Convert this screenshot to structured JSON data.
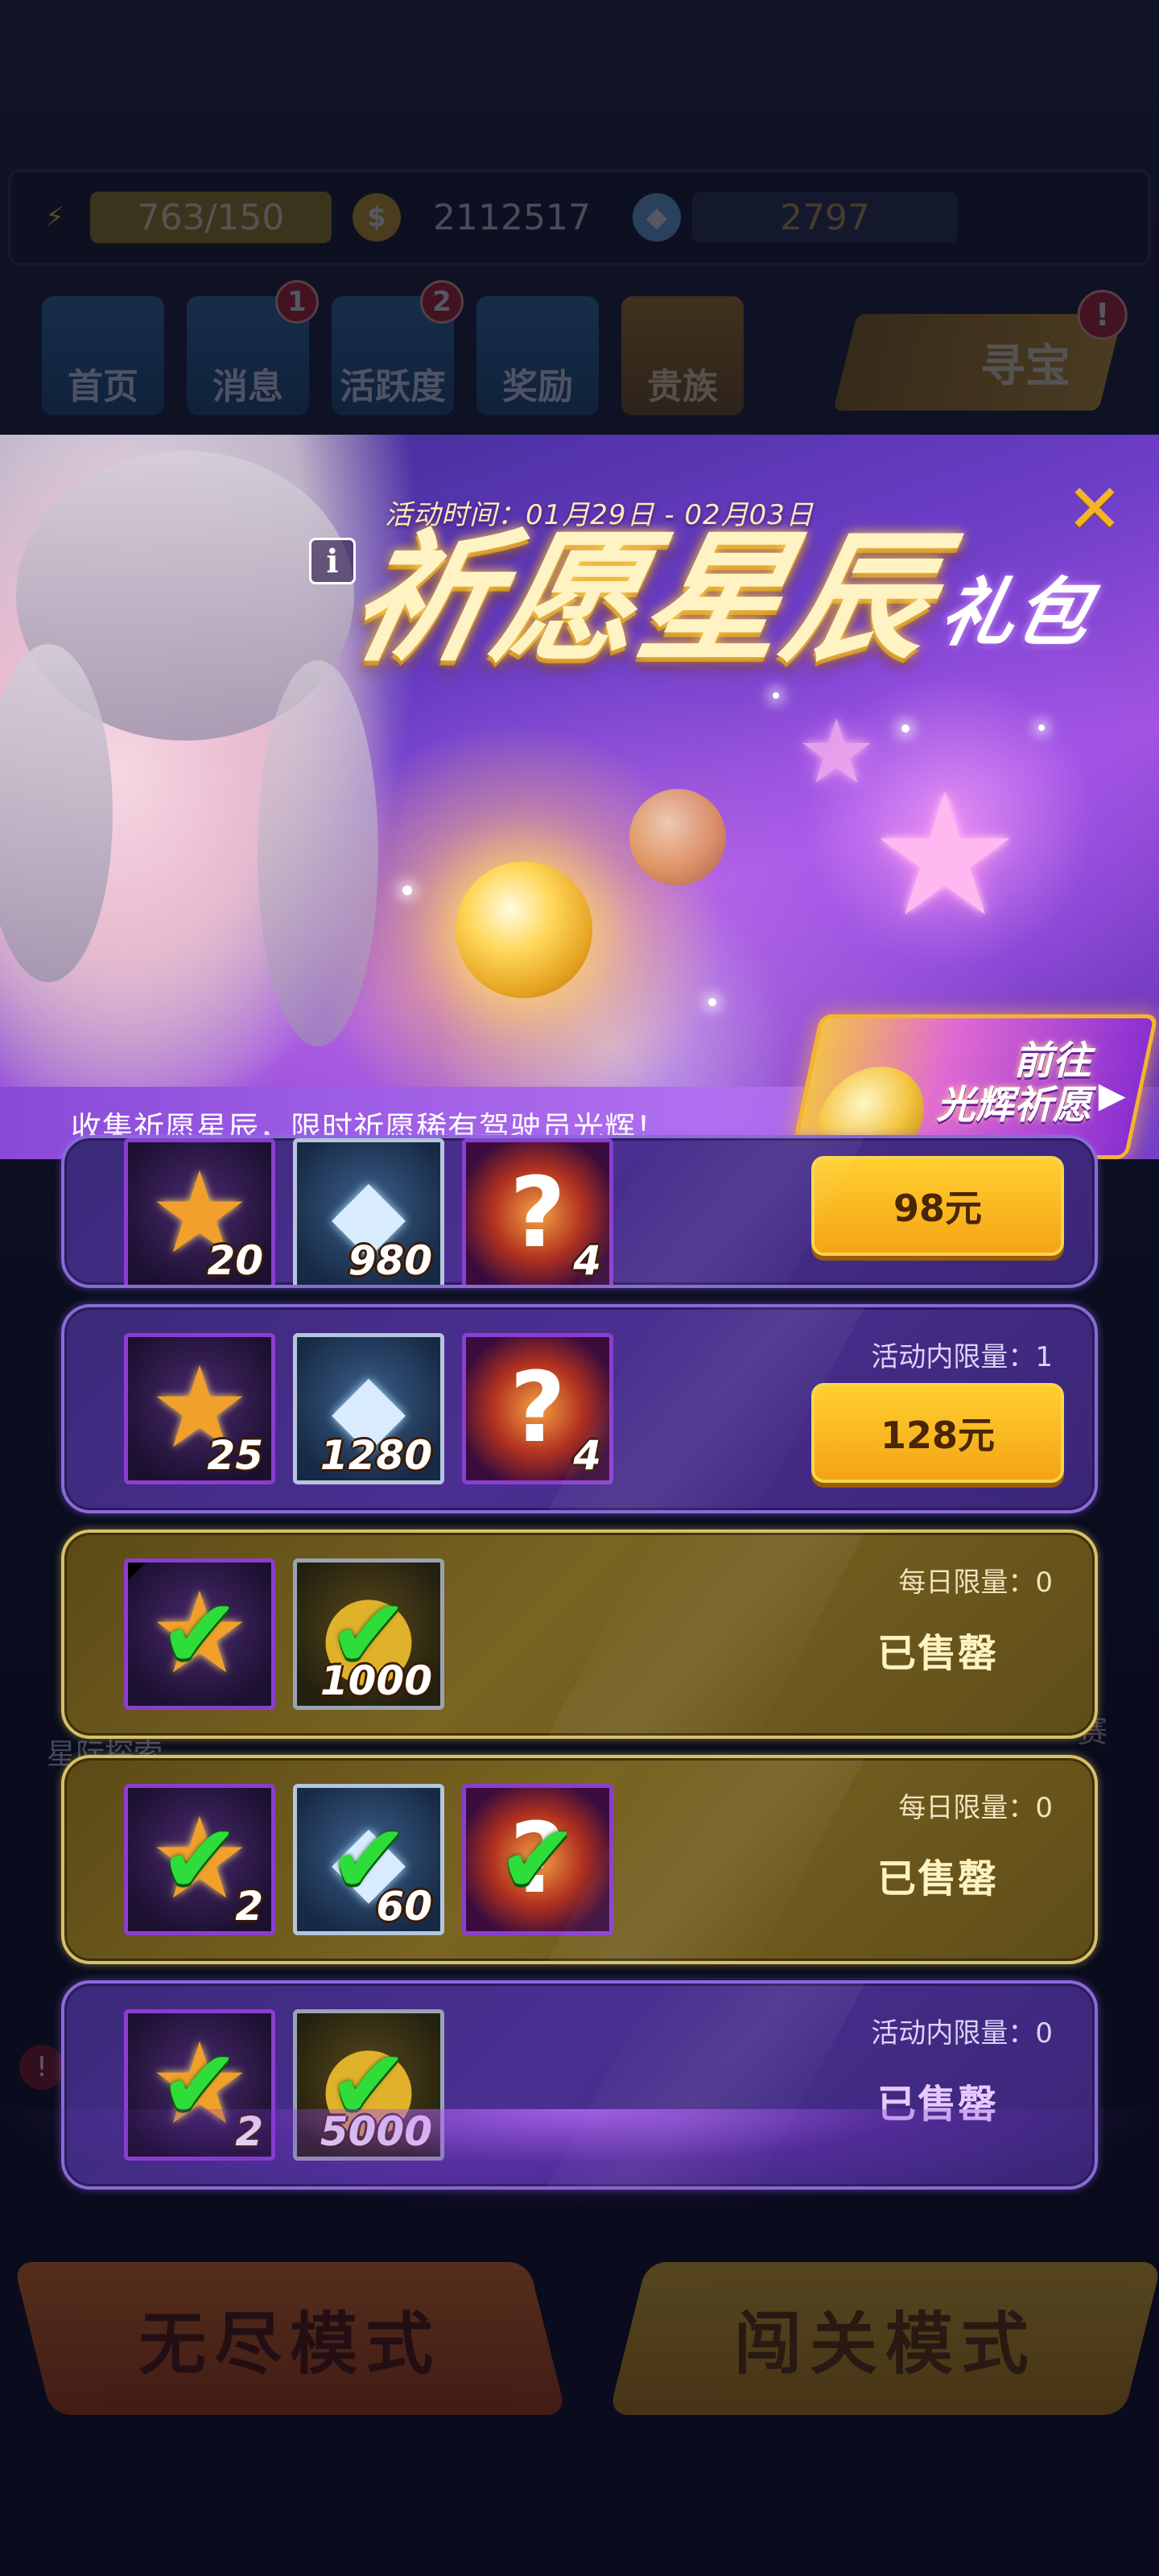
{
  "top_bar": {
    "energy": "763/150",
    "coins": "2112517",
    "gems": "2797"
  },
  "nav": [
    {
      "label": "首页",
      "badge": ""
    },
    {
      "label": "消息",
      "badge": "1"
    },
    {
      "label": "活跃度",
      "badge": "2"
    },
    {
      "label": "奖励",
      "badge": ""
    },
    {
      "label": "贵族",
      "badge": ""
    }
  ],
  "treasure": {
    "label": "寻宝",
    "badge": "!"
  },
  "background_labels": {
    "left": "星际探索",
    "right": "赛",
    "badge": "!"
  },
  "modes": {
    "endless": "无尽模式",
    "stage": "闯关模式"
  },
  "event": {
    "time": "活动时间：01月29日 - 02月03日",
    "title_main": "祈愿星辰",
    "title_sub": "礼包",
    "info_icon": "i",
    "close_icon": "✕",
    "description": "收集祈愿星辰，限时祈愿稀有驾驶员光辉！",
    "goto_line1": "前往",
    "goto_line2": "光辉祈愿"
  },
  "packs": [
    {
      "style": "purple",
      "limit": "",
      "price": "98元",
      "status": "",
      "items": [
        {
          "icon": "star-shard",
          "qty": "20",
          "claimed": false
        },
        {
          "icon": "diamond",
          "qty": "980",
          "claimed": false
        },
        {
          "icon": "mystery-orb",
          "qty": "4",
          "claimed": false
        }
      ]
    },
    {
      "style": "purple",
      "limit": "活动内限量：1",
      "price": "128元",
      "status": "",
      "items": [
        {
          "icon": "star-shard",
          "qty": "25",
          "claimed": false
        },
        {
          "icon": "diamond",
          "qty": "1280",
          "claimed": false
        },
        {
          "icon": "mystery-orb",
          "qty": "4",
          "claimed": false
        }
      ]
    },
    {
      "style": "gold",
      "limit": "每日限量：0",
      "price": "",
      "status": "已售罄",
      "items": [
        {
          "icon": "star-shard",
          "qty": "",
          "claimed": true
        },
        {
          "icon": "gold-coin",
          "qty": "1000",
          "claimed": true
        }
      ]
    },
    {
      "style": "gold",
      "limit": "每日限量：0",
      "price": "",
      "status": "已售罄",
      "items": [
        {
          "icon": "star-shard",
          "qty": "2",
          "claimed": true
        },
        {
          "icon": "diamond",
          "qty": "60",
          "claimed": true
        },
        {
          "icon": "mystery-orb",
          "qty": "",
          "claimed": true
        }
      ]
    },
    {
      "style": "purple",
      "limit": "活动内限量：0",
      "price": "",
      "status": "已售罄",
      "items": [
        {
          "icon": "star-shard",
          "qty": "2",
          "claimed": true
        },
        {
          "icon": "gold-coin",
          "qty": "5000",
          "claimed": true
        }
      ]
    }
  ],
  "colors": {
    "accent_gold": "#f3b42a",
    "purple_frame": "#8a6ad8",
    "gold_frame": "#d8c067",
    "claimed_check": "#2edc3a"
  }
}
